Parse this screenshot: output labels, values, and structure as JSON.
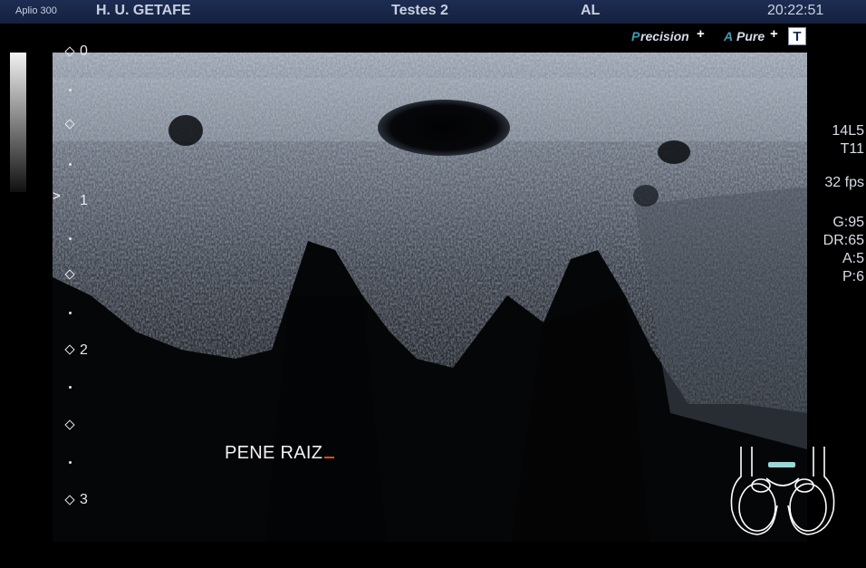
{
  "header": {
    "model": "Aplio 300",
    "hospital": "H. U. GETAFE",
    "preset": "Testes 2",
    "operator": "AL",
    "time": "20:22:51"
  },
  "modes": {
    "precision": {
      "first": "P",
      "rest": "recision",
      "plus": "+"
    },
    "apure": {
      "first": "A",
      "rest": "Pure",
      "plus": "+"
    },
    "tissue_label": "T"
  },
  "params": {
    "probe": "14L5",
    "tissue": "T11",
    "fps": "32 fps",
    "gain": "G:95",
    "dr": "DR:65",
    "a": "A:5",
    "p": "P:6"
  },
  "depth_scale": {
    "labels": [
      "0",
      "1",
      "2",
      "3"
    ]
  },
  "focus_marker": ">",
  "annotation": "PENE RAIZ",
  "colors": {
    "header_bg": "#1d2c52",
    "accent": "#3c9db5",
    "cursor": "#e04a1e",
    "bodymark_probe": "#9ad8d8"
  }
}
